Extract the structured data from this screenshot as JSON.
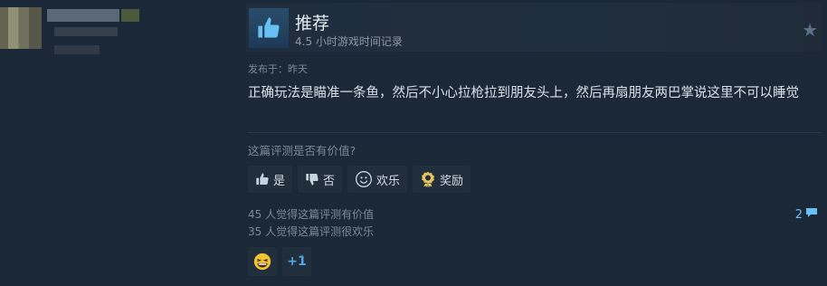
{
  "review": {
    "recommendation": "推荐",
    "hours": "4.5 小时游戏时间记录",
    "posted": "发布于：昨天",
    "body": "正确玩法是瞄准一条鱼，然后不小心拉枪拉到朋友头上，然后再扇朋友两巴掌说这里不可以睡觉",
    "helpful_question": "这篇评测是否有价值?",
    "buttons": {
      "yes": "是",
      "no": "否",
      "funny": "欢乐",
      "award": "奖励"
    },
    "helpful_count": "45 人觉得这篇评测有价值",
    "funny_count": "35 人觉得这篇评测很欢乐",
    "comment_count": "2",
    "awards": {
      "plus_one": "+1"
    }
  },
  "colors": {
    "background": "#1b2838",
    "link": "#67c1f5",
    "muted": "#7b8a99"
  }
}
